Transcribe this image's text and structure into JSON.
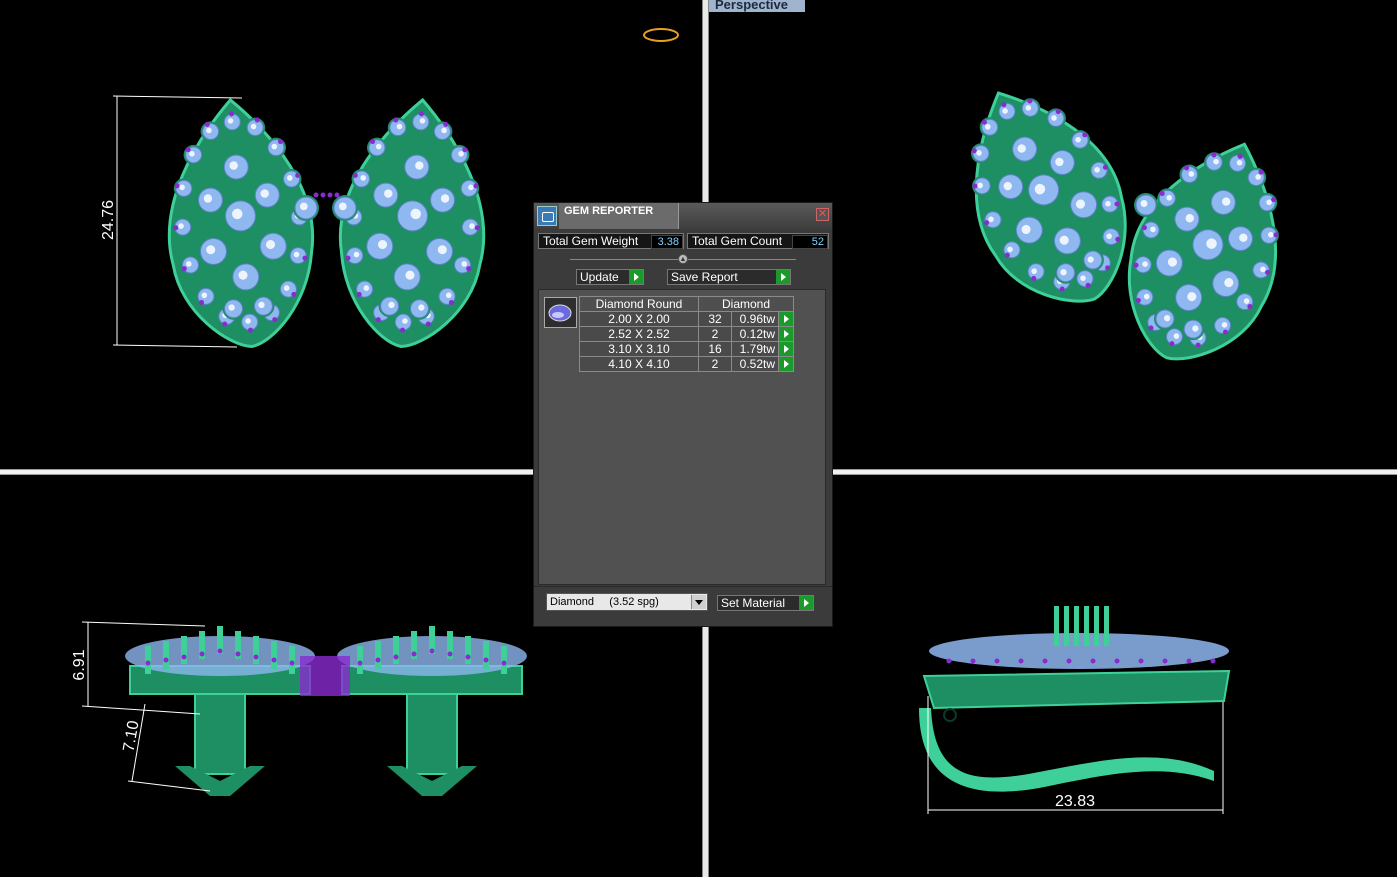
{
  "viewport_label": "Perspective",
  "dimensions": {
    "top_height": "24.76",
    "front_height": "6.91",
    "front_post": "7.10",
    "side_width": "23.83"
  },
  "gem_reporter": {
    "title": "GEM REPORTER",
    "close_symbol": "✕",
    "total_weight_label": "Total Gem Weight",
    "total_weight_value": "3.38",
    "total_count_label": "Total Gem Count",
    "total_count_value": "52",
    "update_label": "Update",
    "save_report_label": "Save Report",
    "table": {
      "header_shape": "Diamond Round",
      "header_material": "Diamond",
      "rows": [
        {
          "size": "2.00 X 2.00",
          "count": "32",
          "weight": "0.96tw"
        },
        {
          "size": "2.52 X 2.52",
          "count": "2",
          "weight": "0.12tw"
        },
        {
          "size": "3.10 X 3.10",
          "count": "16",
          "weight": "1.79tw"
        },
        {
          "size": "4.10 X 4.10",
          "count": "2",
          "weight": "0.52tw"
        }
      ]
    },
    "material_select_value": "Diamond     (3.52 spg)",
    "set_material_label": "Set Material"
  },
  "colors": {
    "metal": "#1d8f62",
    "metal_light": "#3fd09a",
    "gem": "#8fb7f0",
    "gem_highlight": "#ffffff",
    "accent_gem": "#8a2bd0",
    "go_button": "#1a9a2a"
  }
}
